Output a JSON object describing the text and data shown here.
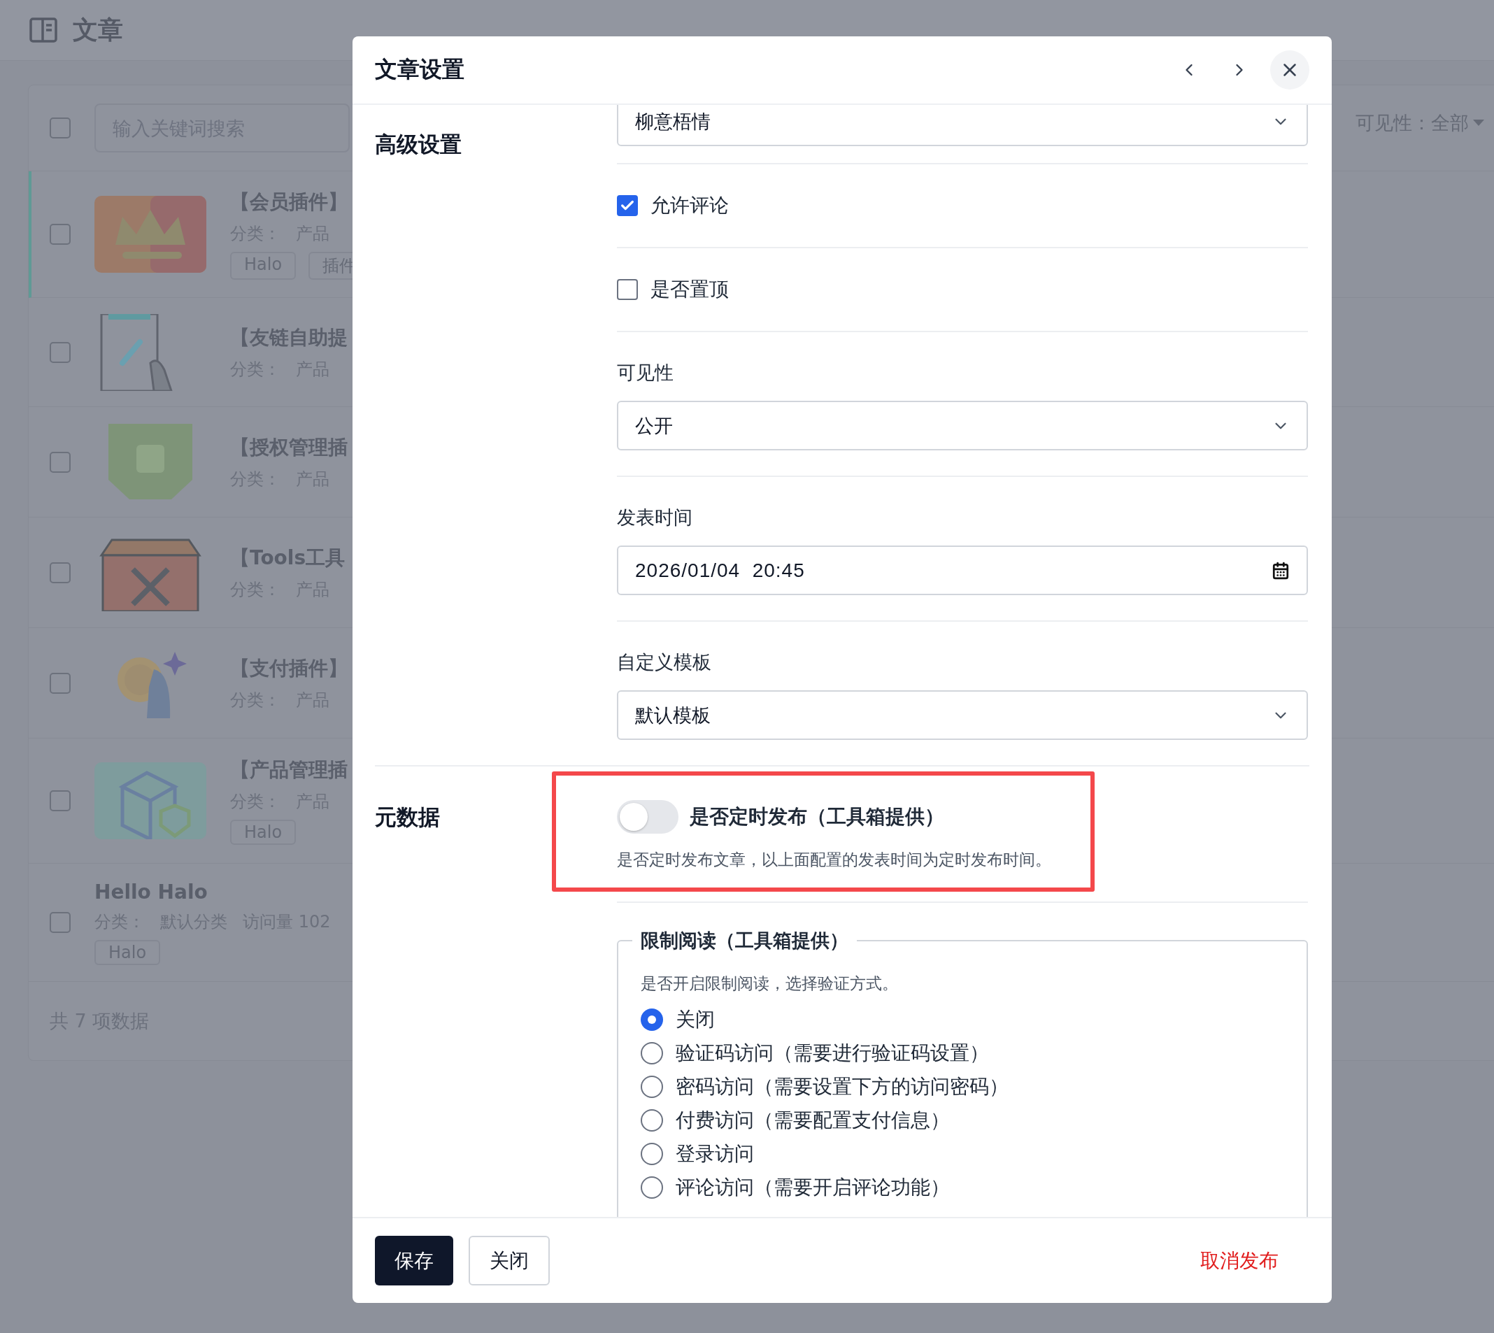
{
  "page": {
    "title": "文章"
  },
  "list": {
    "select_all": {
      "checked": false
    },
    "search": {
      "placeholder": "输入关键词搜索"
    },
    "filter": {
      "label": "可见性：",
      "value": "全部"
    },
    "rows": [
      {
        "title": "【会员插件】",
        "meta": [
          "分类：",
          "产品"
        ],
        "tags": [
          "Halo",
          "插件"
        ],
        "thumbnail": true,
        "active": true,
        "checked": false
      },
      {
        "title": "【友链自助提",
        "meta": [
          "分类：",
          "产品"
        ],
        "tags": [],
        "thumbnail": true,
        "active": false,
        "checked": false
      },
      {
        "title": "【授权管理插",
        "meta": [
          "分类：",
          "产品"
        ],
        "tags": [],
        "thumbnail": true,
        "active": false,
        "checked": false
      },
      {
        "title": "【Tools工具",
        "meta": [
          "分类：",
          "产品"
        ],
        "tags": [],
        "thumbnail": true,
        "active": false,
        "checked": false
      },
      {
        "title": "【支付插件】",
        "meta": [
          "分类：",
          "产品"
        ],
        "tags": [],
        "thumbnail": true,
        "active": false,
        "checked": false
      },
      {
        "title": "【产品管理插",
        "meta": [
          "分类：",
          "产品"
        ],
        "tags": [
          "Halo"
        ],
        "thumbnail": true,
        "active": false,
        "checked": false
      },
      {
        "title": "Hello Halo",
        "meta": [
          "分类：",
          "默认分类",
          "访问量 102"
        ],
        "tags": [
          "Halo"
        ],
        "thumbnail": false,
        "active": false,
        "checked": false
      }
    ],
    "footer": "共 7 项数据"
  },
  "dialog": {
    "title": "文章设置",
    "sections": [
      {
        "label": "高级设置",
        "fields": [
          {
            "kind": "select",
            "value": "柳意梧情"
          },
          {
            "kind": "checkbox",
            "label": "允许评论",
            "checked": true
          },
          {
            "kind": "checkbox",
            "label": "是否置顶",
            "checked": false
          },
          {
            "kind": "select",
            "label": "可见性",
            "value": "公开"
          },
          {
            "kind": "datetime",
            "label": "发表时间",
            "value": "2026/01/04  20:45"
          },
          {
            "kind": "select",
            "label": "自定义模板",
            "value": "默认模板"
          }
        ]
      },
      {
        "label": "元数据",
        "fields": [
          {
            "kind": "switch",
            "label": "是否定时发布（工具箱提供）",
            "help": "是否定时发布文章，以上面配置的发表时间为定时发布时间。",
            "on": false,
            "highlighted": true
          },
          {
            "kind": "radio_group",
            "legend": "限制阅读（工具箱提供）",
            "help": "是否开启限制阅读，选择验证方式。",
            "options": [
              {
                "label": "关闭",
                "selected": true
              },
              {
                "label": "验证码访问（需要进行验证码设置）",
                "selected": false
              },
              {
                "label": "密码访问（需要设置下方的访问密码）",
                "selected": false
              },
              {
                "label": "付费访问（需要配置支付信息）",
                "selected": false
              },
              {
                "label": "登录访问",
                "selected": false
              },
              {
                "label": "评论访问（需要开启评论功能）",
                "selected": false
              }
            ]
          }
        ]
      }
    ],
    "buttons": [
      {
        "label": "保存",
        "kind": "primary"
      },
      {
        "label": "关闭",
        "kind": "default"
      },
      {
        "label": "取消发布",
        "kind": "danger"
      }
    ]
  }
}
